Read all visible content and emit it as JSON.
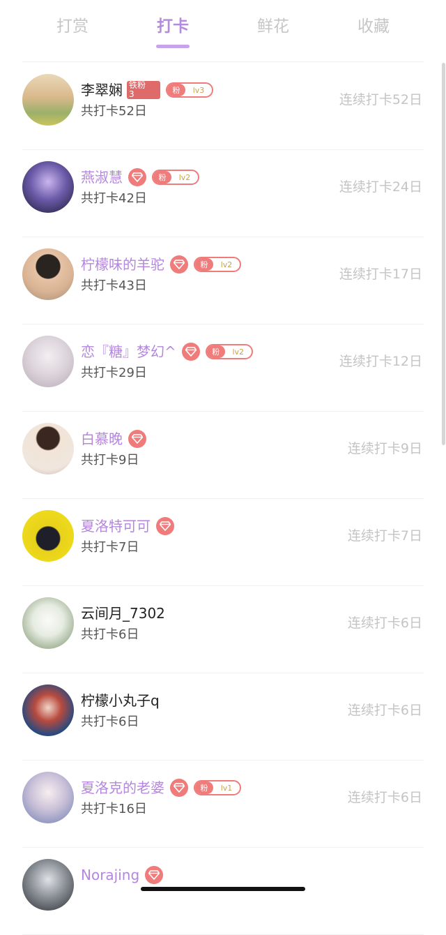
{
  "tabs": [
    {
      "label": "打赏",
      "active": false
    },
    {
      "label": "打卡",
      "active": true
    },
    {
      "label": "鲜花",
      "active": false
    },
    {
      "label": "收藏",
      "active": false
    }
  ],
  "colors": {
    "accent": "#b48be0",
    "vip_name": "#b486de",
    "badge": "#f07b7b",
    "iron_fan": "#df6a6a"
  },
  "rows": [
    {
      "name": "李翠娴",
      "vip": false,
      "iron_badge": "铁粉\n3",
      "fan_label": "粉",
      "fan_level": "lv3",
      "total": "共打卡52日",
      "streak": "连续打卡52日"
    },
    {
      "name": "燕淑慧",
      "vip": true,
      "fan_label": "粉",
      "fan_level": "lv2",
      "total": "共打卡42日",
      "streak": "连续打卡24日"
    },
    {
      "name": "柠檬味的羊驼",
      "vip": true,
      "fan_label": "粉",
      "fan_level": "lv2",
      "total": "共打卡43日",
      "streak": "连续打卡17日"
    },
    {
      "name": "恋『糖』梦幻^",
      "vip": true,
      "fan_label": "粉",
      "fan_level": "lv2",
      "total": "共打卡29日",
      "streak": "连续打卡12日"
    },
    {
      "name": "白慕晚",
      "vip": true,
      "total": "共打卡9日",
      "streak": "连续打卡9日"
    },
    {
      "name": "夏洛特可可",
      "vip": true,
      "total": "共打卡7日",
      "streak": "连续打卡7日"
    },
    {
      "name": "云间月_7302",
      "vip": false,
      "total": "共打卡6日",
      "streak": "连续打卡6日"
    },
    {
      "name": "柠檬小丸子q",
      "vip": false,
      "total": "共打卡6日",
      "streak": "连续打卡6日"
    },
    {
      "name": "夏洛克的老婆",
      "vip": true,
      "fan_label": "粉",
      "fan_level": "lv1",
      "total": "共打卡16日",
      "streak": "连续打卡6日"
    },
    {
      "name": "Norajing",
      "vip": true,
      "total": "",
      "streak": ""
    }
  ]
}
